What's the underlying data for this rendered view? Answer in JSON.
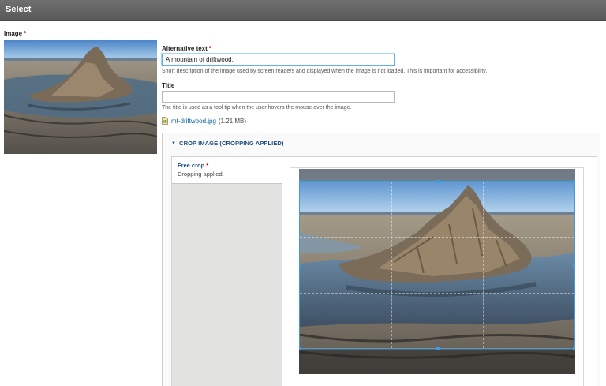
{
  "dialog": {
    "title": "Select"
  },
  "image_field": {
    "label": "Image",
    "required_mark": "*"
  },
  "alt_text": {
    "label": "Alternative text",
    "required_mark": "*",
    "value": "A mountain of driftwood.",
    "description": "Short description of the image used by screen readers and displayed when the image is not loaded. This is important for accessibility."
  },
  "title_field": {
    "label": "Title",
    "value": "",
    "description": "The title is used as a tool tip when the user hovers the mouse over the image."
  },
  "file": {
    "name": "mt-driftwood.jpg",
    "size": "(1.21 MB)",
    "icon": "image-file-icon"
  },
  "crop": {
    "summary": "CROP IMAGE (CROPPING APPLIED)",
    "expanded": true,
    "tab_title": "Free crop",
    "tab_required_mark": "*",
    "tab_status": "Cropping applied."
  },
  "colors": {
    "accent": "#3d9bde",
    "link": "#0a64a4",
    "required": "#e00000",
    "titlebar": "#616161"
  }
}
